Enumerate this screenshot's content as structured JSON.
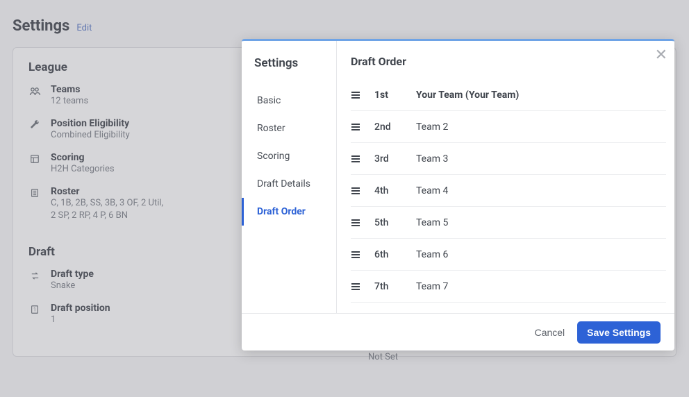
{
  "page": {
    "title": "Settings",
    "edit_link": "Edit"
  },
  "league": {
    "header": "League",
    "items": [
      {
        "icon": "teams-icon",
        "label": "Teams",
        "value": "12 teams"
      },
      {
        "icon": "wrench-icon",
        "label": "Position Eligibility",
        "value": "Combined Eligibility"
      },
      {
        "icon": "scoring-icon",
        "label": "Scoring",
        "value": "H2H Categories"
      },
      {
        "icon": "roster-icon",
        "label": "Roster",
        "value": "C, 1B, 2B, SS, 3B, 3 OF, 2 Util,",
        "value2": "2 SP, 2 RP, 4 P, 6 BN"
      }
    ]
  },
  "draft": {
    "header": "Draft",
    "items": [
      {
        "icon": "arrows-icon",
        "label": "Draft type",
        "value": "Snake"
      },
      {
        "icon": "position-icon",
        "label": "Draft position",
        "value": "1"
      }
    ]
  },
  "notset": "Not Set",
  "modal": {
    "sidebar_title": "Settings",
    "content_title": "Draft Order",
    "nav": [
      {
        "label": "Basic",
        "active": false
      },
      {
        "label": "Roster",
        "active": false
      },
      {
        "label": "Scoring",
        "active": false
      },
      {
        "label": "Draft Details",
        "active": false
      },
      {
        "label": "Draft Order",
        "active": true
      }
    ],
    "order": [
      {
        "rank": "1st",
        "team": "Your Team (Your Team)",
        "first": true
      },
      {
        "rank": "2nd",
        "team": "Team 2"
      },
      {
        "rank": "3rd",
        "team": "Team 3"
      },
      {
        "rank": "4th",
        "team": "Team 4"
      },
      {
        "rank": "5th",
        "team": "Team 5"
      },
      {
        "rank": "6th",
        "team": "Team 6"
      },
      {
        "rank": "7th",
        "team": "Team 7"
      }
    ],
    "footer": {
      "cancel": "Cancel",
      "save": "Save Settings"
    }
  }
}
